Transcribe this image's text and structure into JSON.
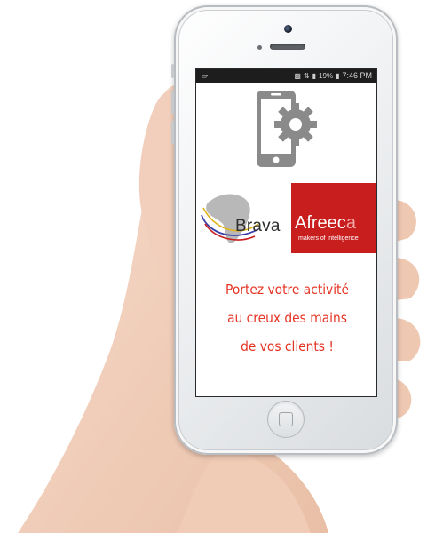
{
  "status_bar": {
    "battery": "19%",
    "time": "7:46 PM"
  },
  "logo": {
    "brava": "Brava",
    "afreeca_main": "Afreec",
    "afreeca_last": "a",
    "tagline": "makers of intelligence"
  },
  "slogan": {
    "line1": "Portez votre activité",
    "line2": "au creux des mains",
    "line3": "de vos clients !"
  },
  "colors": {
    "brand_red": "#c81e1e",
    "slogan_red": "#e53323"
  },
  "icons": [
    "phone-settings-icon",
    "gear-icon",
    "africa-map-logo"
  ]
}
